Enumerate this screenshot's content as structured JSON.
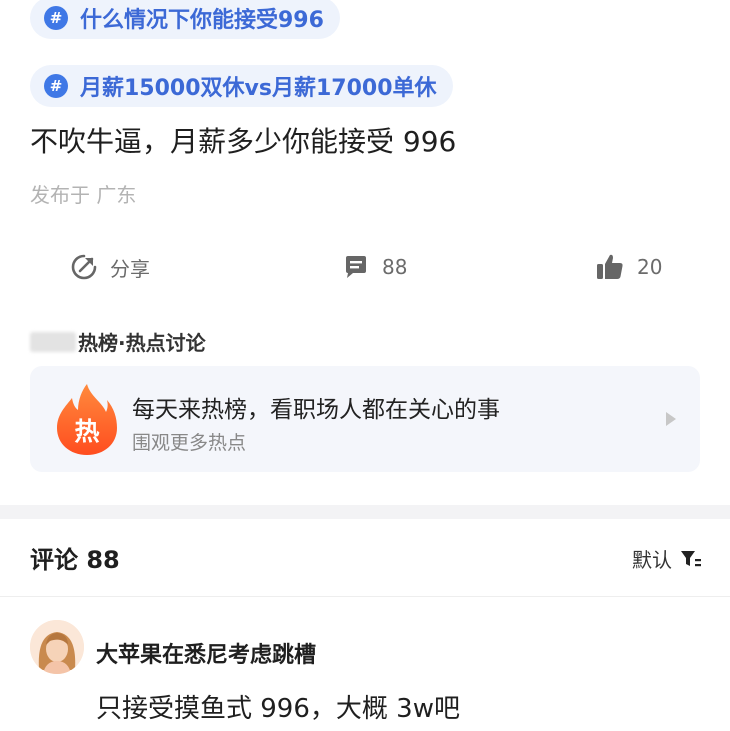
{
  "topics": [
    {
      "label": "什么情况下你能接受996"
    },
    {
      "label": "月薪15000双休vs月薪17000单休"
    }
  ],
  "post": {
    "text": "不吹牛逼，月薪多少你能接受 996",
    "location": "发布于 广东"
  },
  "actions": {
    "share_label": "分享",
    "comment_count": "88",
    "like_count": "20"
  },
  "hot_section": {
    "header": "热榜·热点讨论",
    "card_icon_text": "热",
    "card_title": "每天来热榜，看职场人都在关心的事",
    "card_subtitle": "围观更多热点"
  },
  "comments": {
    "title": "评论 88",
    "sort_label": "默认",
    "items": [
      {
        "author": "大苹果在悉尼考虑跳槽",
        "text": "只接受摸鱼式 996，大概 3w吧"
      }
    ]
  },
  "colors": {
    "accent": "#3c69d6",
    "tag_background": "#eef3fc",
    "fire_orange": "#ff6a2b"
  }
}
